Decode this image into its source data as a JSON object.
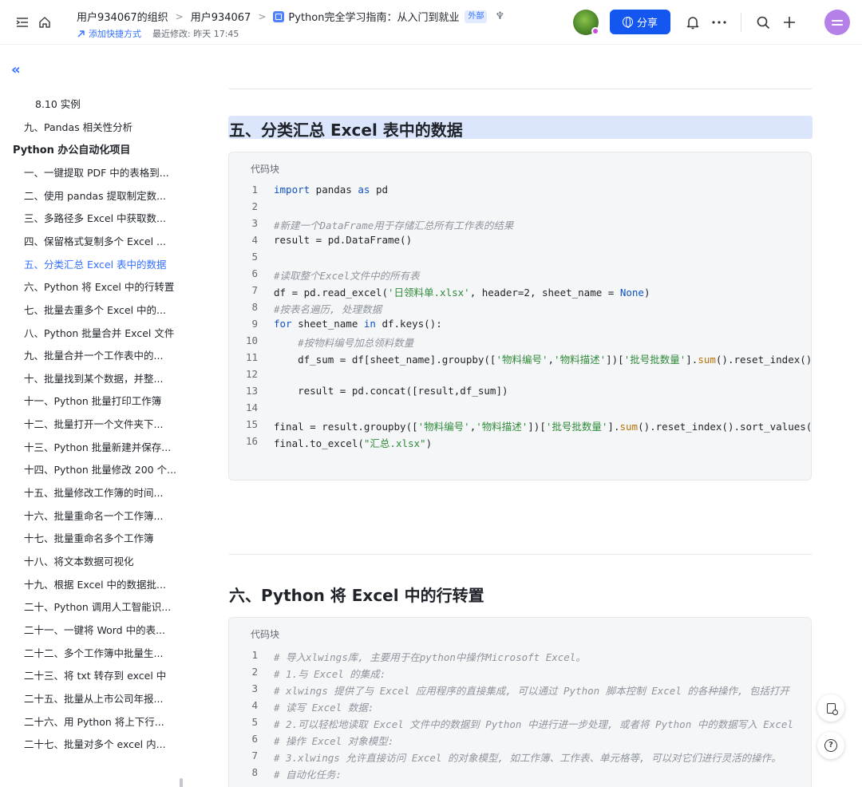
{
  "header": {
    "breadcrumbs": [
      "用户934067的组织",
      "用户934067"
    ],
    "doc_title": "Python完全学习指南：从入门到就业",
    "doc_badge": "外部",
    "add_shortcut": "添加快捷方式",
    "last_modified": "最近修改: 昨天 17:45",
    "share_label": "分享",
    "accent_color": "#1456f0"
  },
  "sidebar": {
    "collapse_icon": "double-chevron-left-icon",
    "items": [
      {
        "label": "8.10 实例",
        "level": 3,
        "active": false
      },
      {
        "label": "九、Pandas 相关性分析",
        "level": 2,
        "active": false
      },
      {
        "label": "Python 办公自动化项目",
        "level": 1,
        "active": false
      },
      {
        "label": "一、一键提取 PDF 中的表格到...",
        "level": 2,
        "active": false
      },
      {
        "label": "二、使用 pandas 提取制定数...",
        "level": 2,
        "active": false
      },
      {
        "label": "三、多路径多 Excel 中获取数...",
        "level": 2,
        "active": false
      },
      {
        "label": "四、保留格式复制多个 Excel ...",
        "level": 2,
        "active": false
      },
      {
        "label": "五、分类汇总 Excel 表中的数据",
        "level": 2,
        "active": true
      },
      {
        "label": "六、Python 将 Excel 中的行转置",
        "level": 2,
        "active": false
      },
      {
        "label": "七、批量去重多个 Excel 中的...",
        "level": 2,
        "active": false
      },
      {
        "label": "八、Python 批量合并 Excel 文件",
        "level": 2,
        "active": false
      },
      {
        "label": "九、批量合并一个工作表中的...",
        "level": 2,
        "active": false
      },
      {
        "label": "十、批量找到某个数据，并整...",
        "level": 2,
        "active": false
      },
      {
        "label": "十一、Python 批量打印工作簿",
        "level": 2,
        "active": false
      },
      {
        "label": "十二、批量打开一个文件夹下...",
        "level": 2,
        "active": false
      },
      {
        "label": "十三、Python 批量新建并保存...",
        "level": 2,
        "active": false
      },
      {
        "label": "十四、Python 批量修改 200 个...",
        "level": 2,
        "active": false
      },
      {
        "label": "十五、批量修改工作簿的时间...",
        "level": 2,
        "active": false
      },
      {
        "label": "十六、批量重命名一个工作簿...",
        "level": 2,
        "active": false
      },
      {
        "label": "十七、批量重命名多个工作簿",
        "level": 2,
        "active": false
      },
      {
        "label": "十八、将文本数据可视化",
        "level": 2,
        "active": false
      },
      {
        "label": "十九、根据 Excel 中的数据批...",
        "level": 2,
        "active": false
      },
      {
        "label": "二十、Python 调用人工智能识...",
        "level": 2,
        "active": false
      },
      {
        "label": "二十一、一键将 Word 中的表...",
        "level": 2,
        "active": false
      },
      {
        "label": "二十二、多个工作簿中批量生...",
        "level": 2,
        "active": false
      },
      {
        "label": "二十三、将 txt 转存到 excel 中",
        "level": 2,
        "active": false
      },
      {
        "label": "二十五、批量从上市公司年报...",
        "level": 2,
        "active": false
      },
      {
        "label": "二十六、用 Python 将上下行...",
        "level": 2,
        "active": false
      },
      {
        "label": "二十七、批量对多个 excel 内...",
        "level": 2,
        "active": false
      }
    ]
  },
  "sections": [
    {
      "heading": "五、分类汇总 Excel 表中的数据",
      "code_label": "代码块",
      "lines": [
        [
          [
            "kw",
            "import"
          ],
          [
            "t",
            " pandas "
          ],
          [
            "kw",
            "as"
          ],
          [
            "t",
            " pd"
          ]
        ],
        [],
        [
          [
            "cm",
            "#新建一个DataFrame用于存储汇总所有工作表的结果"
          ]
        ],
        [
          [
            "t",
            "result = pd.DataFrame()"
          ]
        ],
        [],
        [
          [
            "cm",
            "#读取整个Excel文件中的所有表"
          ]
        ],
        [
          [
            "t",
            "df = pd.read_excel("
          ],
          [
            "str",
            "'日领料单.xlsx'"
          ],
          [
            "t",
            ", header=2, sheet_name = "
          ],
          [
            "cst",
            "None"
          ],
          [
            "t",
            ")"
          ]
        ],
        [
          [
            "cm",
            "#按表名遍历, 处理数据"
          ]
        ],
        [
          [
            "kw",
            "for"
          ],
          [
            "t",
            " sheet_name "
          ],
          [
            "kw",
            "in"
          ],
          [
            "t",
            " df.keys():"
          ]
        ],
        [
          [
            "t",
            "    "
          ],
          [
            "cm",
            "#按物料编号加总领料数量"
          ]
        ],
        [
          [
            "t",
            "    df_sum = df[sheet_name].groupby(["
          ],
          [
            "str",
            "'物料编号'"
          ],
          [
            "t",
            ","
          ],
          [
            "str",
            "'物料描述'"
          ],
          [
            "t",
            "])["
          ],
          [
            "str",
            "'批号批数量'"
          ],
          [
            "t",
            "]."
          ],
          [
            "fn",
            "sum"
          ],
          [
            "t",
            "().reset_index()"
          ]
        ],
        [],
        [
          [
            "t",
            "    result = pd.concat([result,df_sum])"
          ]
        ],
        [],
        [
          [
            "t",
            "final = result.groupby(["
          ],
          [
            "str",
            "'物料编号'"
          ],
          [
            "t",
            ","
          ],
          [
            "str",
            "'物料描述'"
          ],
          [
            "t",
            "])["
          ],
          [
            "str",
            "'批号批数量'"
          ],
          [
            "t",
            "]."
          ],
          [
            "fn",
            "sum"
          ],
          [
            "t",
            "().reset_index().sort_values()"
          ]
        ],
        [
          [
            "t",
            "final.to_excel("
          ],
          [
            "str",
            "\"汇总.xlsx\""
          ],
          [
            "t",
            ")"
          ]
        ]
      ]
    },
    {
      "heading": "六、Python 将 Excel 中的行转置",
      "code_label": "代码块",
      "lines": [
        [
          [
            "cm",
            "# 导入xlwings库, 主要用于在python中操作Microsoft Excel。"
          ]
        ],
        [
          [
            "cm",
            "# 1.与 Excel 的集成:"
          ]
        ],
        [
          [
            "cm",
            "# xlwings 提供了与 Excel 应用程序的直接集成, 可以通过 Python 脚本控制 Excel 的各种操作, 包括打开"
          ]
        ],
        [
          [
            "cm",
            "# 读写 Excel 数据:"
          ]
        ],
        [
          [
            "cm",
            "# 2.可以轻松地读取 Excel 文件中的数据到 Python 中进行进一步处理, 或者将 Python 中的数据写入 Excel"
          ]
        ],
        [
          [
            "cm",
            "# 操作 Excel 对象模型:"
          ]
        ],
        [
          [
            "cm",
            "# 3.xlwings 允许直接访问 Excel 的对象模型, 如工作簿、工作表、单元格等, 可以对它们进行灵活的操作。"
          ]
        ],
        [
          [
            "cm",
            "# 自动化任务:"
          ]
        ]
      ]
    }
  ]
}
